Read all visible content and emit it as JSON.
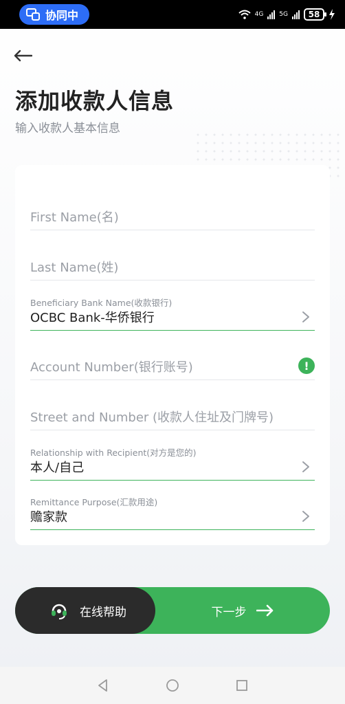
{
  "status_bar": {
    "collab_label": "协同中",
    "net_4g": "4G",
    "net_5g": "5G",
    "battery": "58"
  },
  "header": {
    "title": "添加收款人信息",
    "subtitle": "输入收款人基本信息"
  },
  "form": {
    "first_name": {
      "placeholder": "First Name(名)"
    },
    "last_name": {
      "placeholder": "Last Name(姓)"
    },
    "bank": {
      "label": "Beneficiary Bank Name(收款银行)",
      "value": "OCBC Bank-华侨银行"
    },
    "account": {
      "placeholder": "Account Number(银行账号)",
      "alert": "!"
    },
    "street": {
      "placeholder": "Street and Number (收款人住址及门牌号)"
    },
    "relationship": {
      "label": "Relationship with Recipient(对方是您的)",
      "value": "本人/自己"
    },
    "purpose": {
      "label": "Remittance Purpose(汇款用途)",
      "value": "赡家款"
    }
  },
  "actions": {
    "help_label": "在线帮助",
    "next_label": "下一步"
  },
  "colors": {
    "accent_green": "#3db35a",
    "dark_button": "#2b2b2b",
    "collab_blue": "#2d6df6"
  }
}
